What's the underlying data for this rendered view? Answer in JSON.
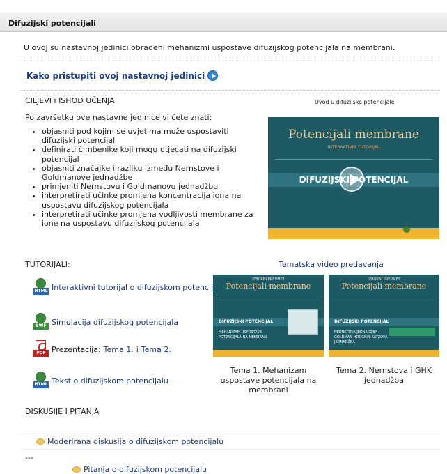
{
  "section": {
    "title": "Difuzijski potencijali"
  },
  "summary": "U ovoj su nastavnoj jedinici obrađeni mehanizmi uspostave difuzijskog potencijala na membrani.",
  "access_link": "Kako pristupiti ovoj nastavnoj jedinici",
  "goals": {
    "heading": "CILJEVI i ISHOD UČENJA",
    "intro": "Po završetku ove nastavne jedinice vi ćete znati:",
    "items": [
      "objasniti pod kojim se uvjetima može uspostaviti difuzijski potencijal",
      "definirati čimbenike koji mogu utjecati na difuzijski potencijal",
      "objasniti značajke i razliku između Nernstove i Goldmanove jednadžbe",
      "primjeniti Nernstovu i Goldmanovu jednadžbu",
      "interpretirati učinke promjena koncentracija iona na uspostavu difuzijskog potencijala",
      "interpretirati učinke promjena vodljivosti membrane za ione na uspostavu difuzijskog potencijala"
    ]
  },
  "intro_video": {
    "caption": "Uvod u difuzijske potencijale",
    "title": "Potencijali membrane",
    "subtitle": "INTERAKTIVNI TUTORIJAL",
    "banner": "DIFUZIJSKI POTENCIJAL"
  },
  "tutorials": {
    "heading": "TUTORIJALI:",
    "items": [
      {
        "badge": "HTML",
        "label": "Interaktivni tutorijal o difuzijskom potencijalu"
      },
      {
        "badge": "SWF",
        "label": "Simulacija difuzijskog potencijala"
      },
      {
        "badge": "PDF",
        "prefix": "Prezentacija:",
        "link1": "Tema 1.",
        "mid": "i",
        "link2": "Tema 2."
      },
      {
        "badge": "HTML",
        "label": "Tekst o difuzijskom potencijalu"
      }
    ]
  },
  "video_lectures": {
    "heading": "Tematska video predavanja",
    "thumbs": [
      {
        "top": "IZBORNI PREDMET",
        "title": "Potencijali membrane",
        "band": "DIFUZIJSKI POTENCIJAL",
        "sub": "MEHANIZAM USPOSTAVE POTENCIJALA NA MEMBRANI",
        "caption": "Tema 1. Mehanizam uspostave potencijala na membrani"
      },
      {
        "top": "IZBORNI PREDMET",
        "title": "Potencijali membrane",
        "band": "DIFUZIJSKI POTENCIJAL",
        "sub": "NERNSTOVA JEDNADŽBA GOLDMAN-HODGKIN-KATZOVA JEDNADŽBA",
        "caption": "Tema 2. Nernstova i GHK jednadžba"
      }
    ]
  },
  "discussion": {
    "heading": "DISKUSIJE I PITANJA",
    "forum1": "Moderirana diskusija o difuzijskom potencijalu",
    "separator": "---",
    "forum2": "Pitanja o difuzijskom potencijalu"
  }
}
